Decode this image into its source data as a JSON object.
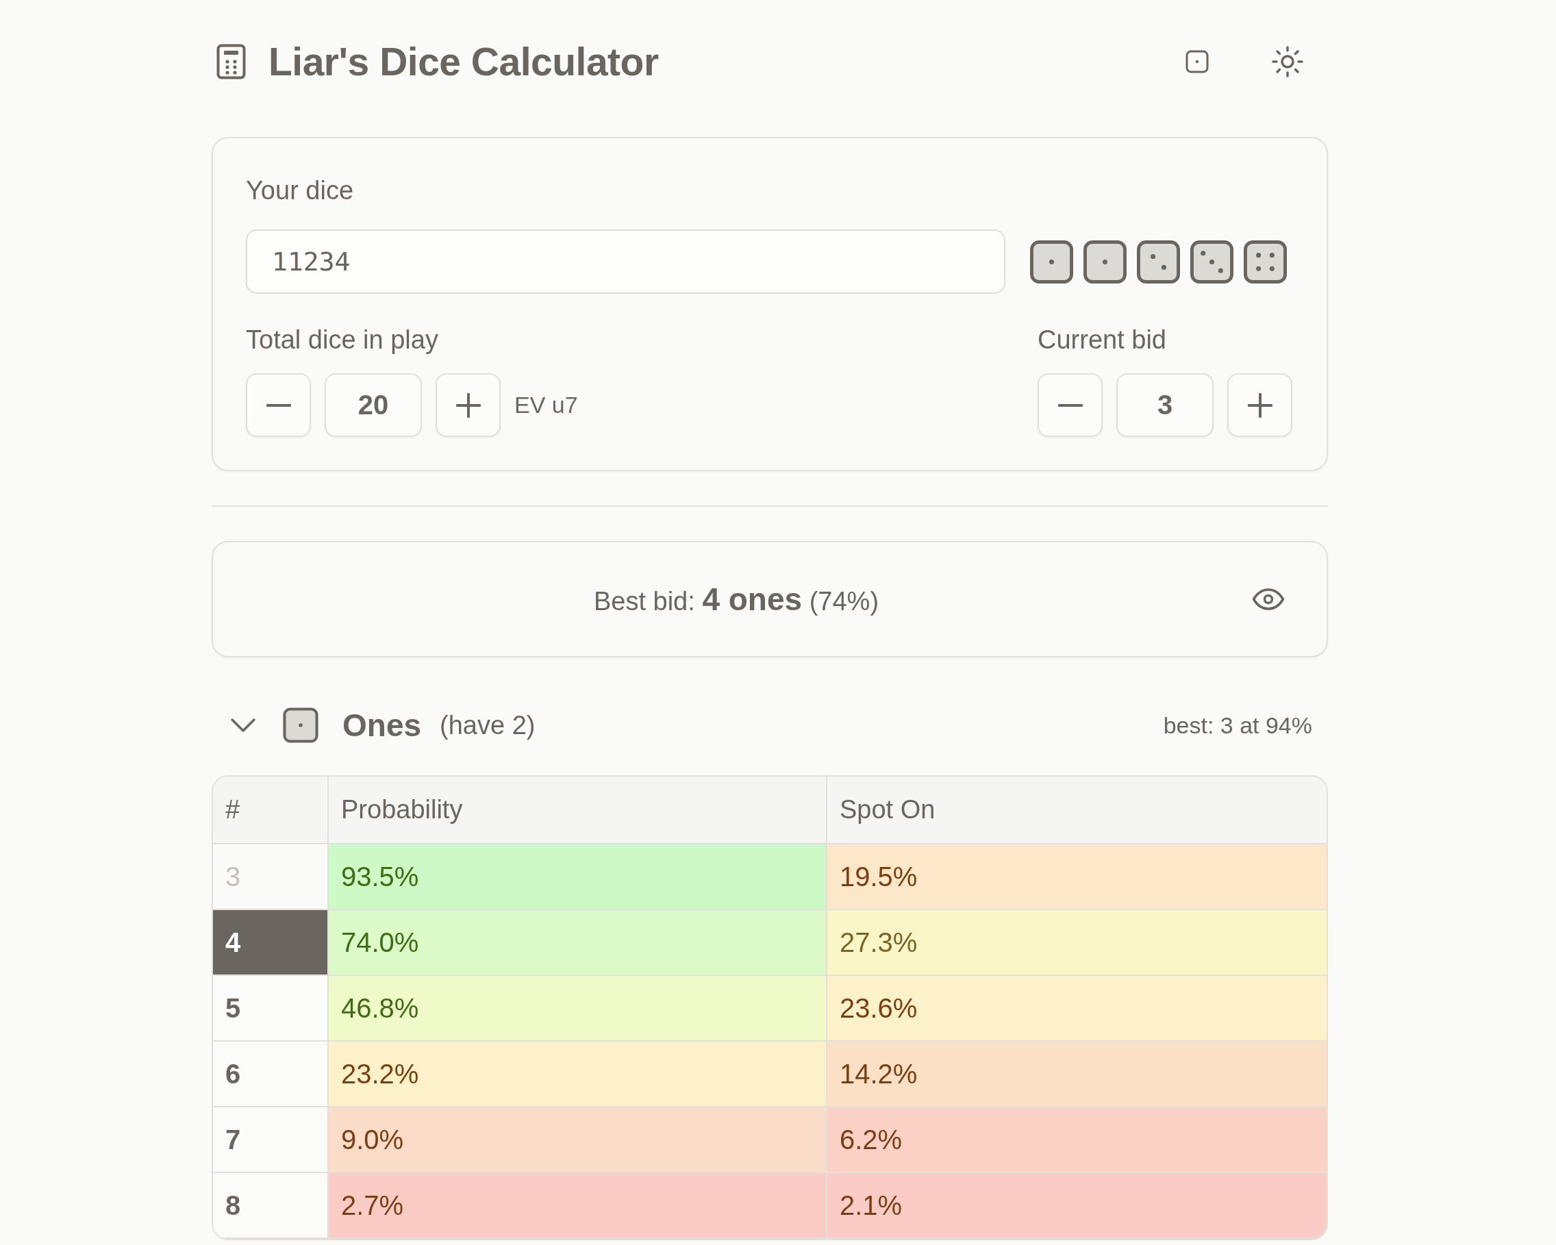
{
  "header": {
    "title": "Liar's Dice Calculator"
  },
  "dice_panel": {
    "label": "Your dice",
    "value": "11234",
    "dice": [
      {
        "kind": "one"
      },
      {
        "kind": "one"
      },
      {
        "kind": "two"
      },
      {
        "kind": "three"
      },
      {
        "kind": "four"
      }
    ],
    "total": {
      "label": "Total dice in play",
      "value": "20",
      "note": "EV u7"
    },
    "bid": {
      "label": "Current bid",
      "value": "3"
    }
  },
  "best_bid": {
    "text": "Best bid: **4 ones** (74%)"
  },
  "groups": [
    {
      "kind": "one",
      "title": "Ones",
      "have": "(have 2)",
      "best": "best: 3 at 94%",
      "expanded": true,
      "table": {
        "columns": [
          "#",
          "Probability",
          "Spot On"
        ],
        "rows": [
          {
            "count": "3",
            "selected": false,
            "disabled": true,
            "probability": {
              "value": "93.5%",
              "color": "#ccf9c5"
            },
            "spot_on": {
              "value": "19.5%",
              "color": "#fce8c8"
            }
          },
          {
            "count": "4",
            "selected": true,
            "disabled": false,
            "probability": {
              "value": "74.0%",
              "color": "#dcf9c8"
            },
            "spot_on": {
              "value": "27.3%",
              "color": "#fbf6c8"
            }
          },
          {
            "count": "5",
            "selected": false,
            "disabled": false,
            "probability": {
              "value": "46.8%",
              "color": "#f0f9c8"
            },
            "spot_on": {
              "value": "23.6%",
              "color": "#fcf1c8"
            }
          },
          {
            "count": "6",
            "selected": false,
            "disabled": false,
            "probability": {
              "value": "23.2%",
              "color": "#fcf1c8"
            },
            "spot_on": {
              "value": "14.2%",
              "color": "#fbe0c5"
            }
          },
          {
            "count": "7",
            "selected": false,
            "disabled": false,
            "probability": {
              "value": "9.0%",
              "color": "#fbdcc8"
            },
            "spot_on": {
              "value": "6.2%",
              "color": "#fbd0c5"
            }
          },
          {
            "count": "8",
            "selected": false,
            "disabled": false,
            "probability": {
              "value": "2.7%",
              "color": "#fbccc5"
            },
            "spot_on": {
              "value": "2.1%",
              "color": "#fbccc5"
            }
          }
        ]
      }
    }
  ]
}
